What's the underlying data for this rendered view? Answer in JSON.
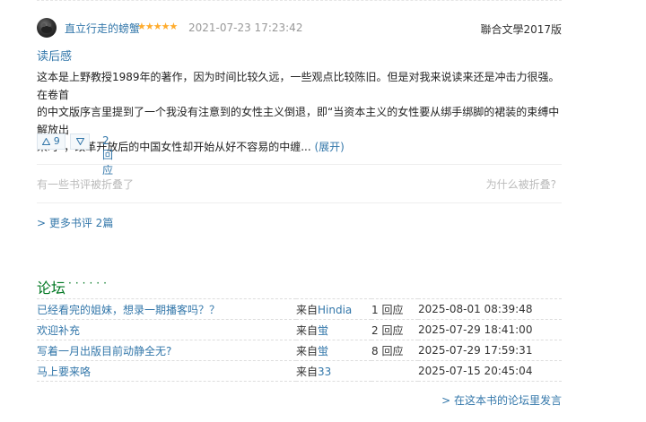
{
  "review": {
    "author": "直立行走的螃蟹",
    "rating": "★★★★★",
    "time": "2021-07-23 17:23:42",
    "edition": "聯合文學2017版",
    "title": "读后感",
    "body_lines": [
      "这本是上野教授1989年的著作，因为时间比较久远，一些观点比较陈旧。但是对我来说读来还是冲击力很强。在卷首",
      "的中文版序言里提到了一个我没有注意到的女性主义倒退，即“当资本主义的女性要从绑手绑脚的裙装的束缚中解放出",
      "来时”，改革开放后的中国女性却开始从好不容易的中缠... "
    ],
    "expand_label": "(展开)",
    "vote_up_icon": "triangle-up-icon",
    "vote_up_count": "9",
    "vote_down_icon": "triangle-down-icon",
    "reply_label": "2回应"
  },
  "folded": {
    "text": "有一些书评被折叠了",
    "why": "为什么被折叠?"
  },
  "more_reviews": "> 更多书评 2篇",
  "forum": {
    "title": "论坛",
    "dots": "······",
    "rows": [
      {
        "topic": "已经看完的姐妹，想录一期播客吗？？",
        "from_prefix": "来自",
        "from_user": "Hindia",
        "replies": "1 回应",
        "time": "2025-08-01 08:39:48"
      },
      {
        "topic": "欢迎补充",
        "from_prefix": "来自",
        "from_user": "蛍",
        "replies": "2 回应",
        "time": "2025-07-29 18:41:00"
      },
      {
        "topic": "写着一月出版目前动静全无?",
        "from_prefix": "来自",
        "from_user": "蛍",
        "replies": "8 回应",
        "time": "2025-07-29 17:59:31"
      },
      {
        "topic": "马上要来咯",
        "from_prefix": "来自",
        "from_user": "33",
        "replies": "",
        "time": "2025-07-15 20:45:04"
      }
    ],
    "more": "> 在这本书的论坛里发言"
  },
  "colors": {
    "link": "#3377aa",
    "forum_title": "#007722",
    "star": "#ffac2d"
  }
}
